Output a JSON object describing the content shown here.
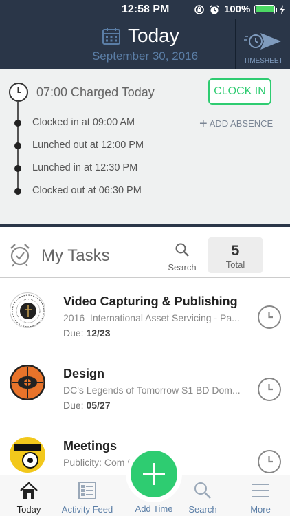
{
  "status_bar": {
    "time": "12:58 PM",
    "battery": "100%"
  },
  "header": {
    "title": "Today",
    "date": "September 30, 2016",
    "timesheet_label": "TIMESHEET"
  },
  "clock": {
    "charged": "07:00 Charged Today",
    "clock_in_label": "CLOCK IN",
    "add_absence_label": "ADD ABSENCE",
    "events": [
      "Clocked in at 09:00 AM",
      "Lunched out at 12:00 PM",
      "Lunched in at 12:30 PM",
      "Clocked out at 06:30 PM"
    ]
  },
  "tasks": {
    "title": "My Tasks",
    "search_label": "Search",
    "total_count": "5",
    "total_label": "Total",
    "items": [
      {
        "name": "Video Capturing & Publishing",
        "project": "2016_International Asset Servicing - Pa...",
        "due_label": "Due:",
        "due": "12/23"
      },
      {
        "name": "Design",
        "project": "DC's Legends of Tomorrow S1 BD Dom...",
        "due_label": "Due:",
        "due": "05/27"
      },
      {
        "name": "Meetings",
        "project": "Publicity: Com                    6 -",
        "due_label": "",
        "due": ""
      }
    ]
  },
  "nav": {
    "today": "Today",
    "activity": "Activity Feed",
    "add_time": "Add Time",
    "search": "Search",
    "more": "More"
  },
  "colors": {
    "header_bg": "#2a3648",
    "accent_green": "#2ecc71",
    "nav_blue": "#5b7ea6"
  }
}
